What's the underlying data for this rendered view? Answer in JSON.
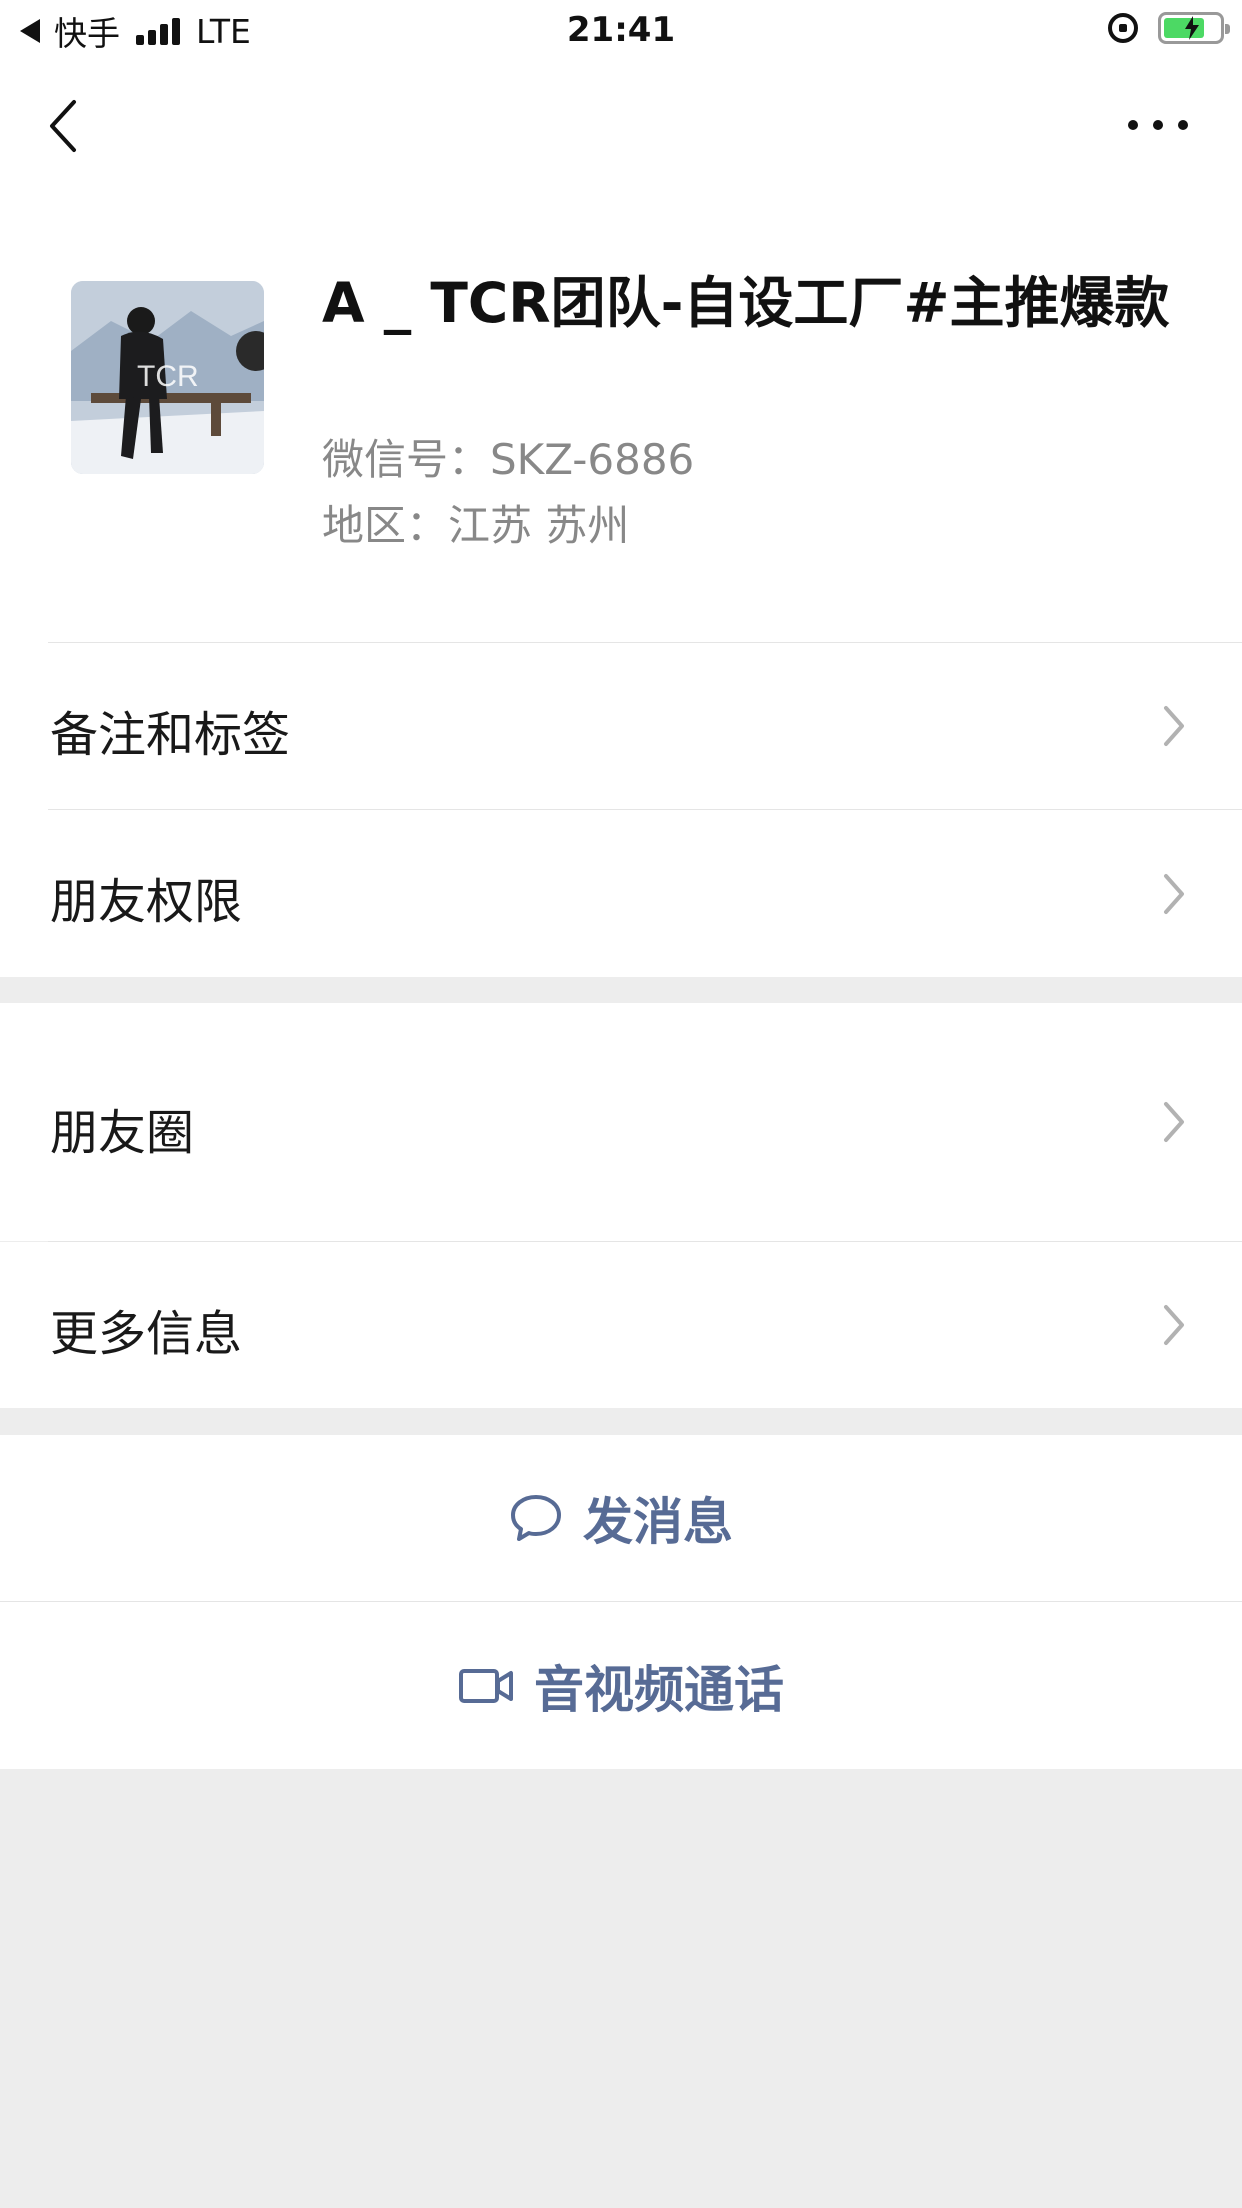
{
  "status_bar": {
    "back_app": "快手",
    "network": "LTE",
    "time": "21:41",
    "battery_icon": "battery-charging-icon",
    "rotation_lock_icon": "rotation-lock-icon"
  },
  "nav": {
    "back_icon": "chevron-left-icon",
    "more_icon": "more-dots-icon"
  },
  "profile": {
    "avatar_text": "TCR",
    "name": "A _ TCR团队-自设工厂#主推爆款",
    "wechat_id": "微信号：SKZ-6886",
    "region": "地区：江苏 苏州"
  },
  "menu": [
    {
      "label": "备注和标签"
    },
    {
      "label": "朋友权限"
    },
    {
      "label": "朋友圈"
    },
    {
      "label": "更多信息"
    }
  ],
  "actions": {
    "message": "发消息",
    "call": "音视频通话"
  },
  "colors": {
    "link_blue": "#576b95",
    "background_gray": "#ededed"
  }
}
